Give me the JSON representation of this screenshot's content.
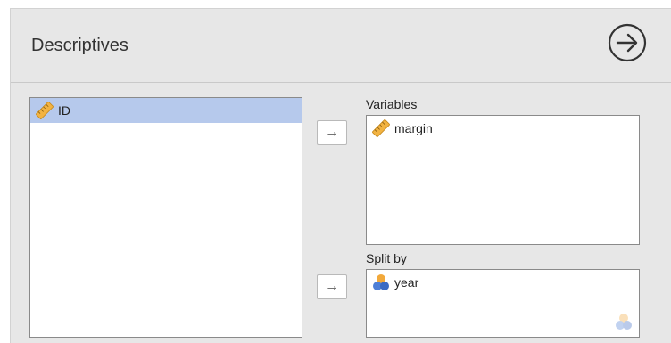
{
  "panel": {
    "title": "Descriptives"
  },
  "source": {
    "items": [
      {
        "label": "ID",
        "icon": "ruler-icon",
        "selected": true
      }
    ]
  },
  "variables": {
    "label": "Variables",
    "items": [
      {
        "label": "margin",
        "icon": "ruler-icon"
      }
    ]
  },
  "split_by": {
    "label": "Split by",
    "items": [
      {
        "label": "year",
        "icon": "nominal-icon"
      }
    ]
  },
  "buttons": {
    "assign_variables": "→",
    "assign_splitby": "→"
  },
  "colors": {
    "panel_bg": "#e7e7e7",
    "selection": "#b6c9ec",
    "ruler": "#f2b342",
    "nominal_blue": "#4f7fd6",
    "nominal_orange": "#f2a93b"
  }
}
